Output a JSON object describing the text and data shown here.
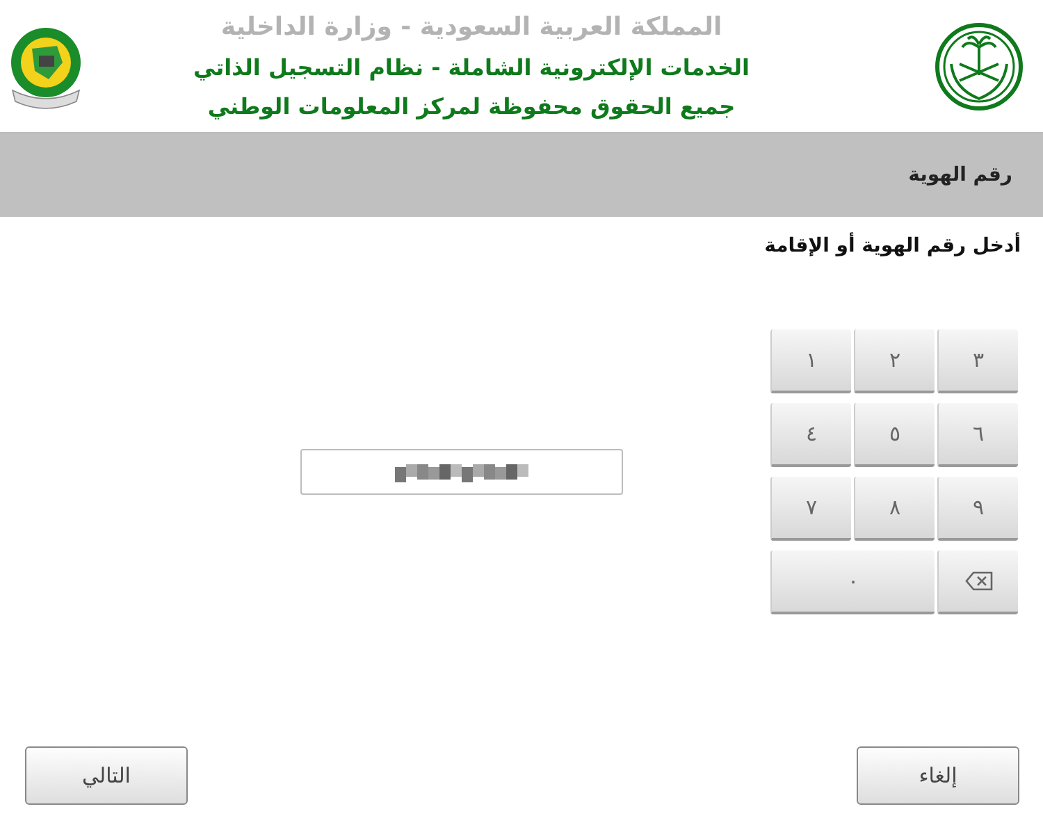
{
  "header": {
    "titles": [
      {
        "text": "المملكة العربية السعودية - وزارة الداخلية",
        "kind": "muted"
      },
      {
        "text": "الخدمات الإلكترونية الشاملة - نظام التسجيل الذاتي",
        "kind": "accent"
      },
      {
        "text": "جميع الحقوق محفوظة لمركز المعلومات الوطني",
        "kind": "accent"
      }
    ]
  },
  "section_bar": {
    "title": "رقم الهوية"
  },
  "prompt": "أدخل رقم الهوية أو الإقامة",
  "id_field": {
    "redacted": true
  },
  "keypad": [
    {
      "kind": "digit",
      "label": "٣"
    },
    {
      "kind": "digit",
      "label": "٢"
    },
    {
      "kind": "digit",
      "label": "١"
    },
    {
      "kind": "digit",
      "label": "٦"
    },
    {
      "kind": "digit",
      "label": "٥"
    },
    {
      "kind": "digit",
      "label": "٤"
    },
    {
      "kind": "digit",
      "label": "٩"
    },
    {
      "kind": "digit",
      "label": "٨"
    },
    {
      "kind": "digit",
      "label": "٧"
    },
    {
      "kind": "backspace"
    },
    {
      "kind": "wide",
      "label": "٠"
    }
  ],
  "buttons": [
    "إلغاء",
    "التالي"
  ]
}
